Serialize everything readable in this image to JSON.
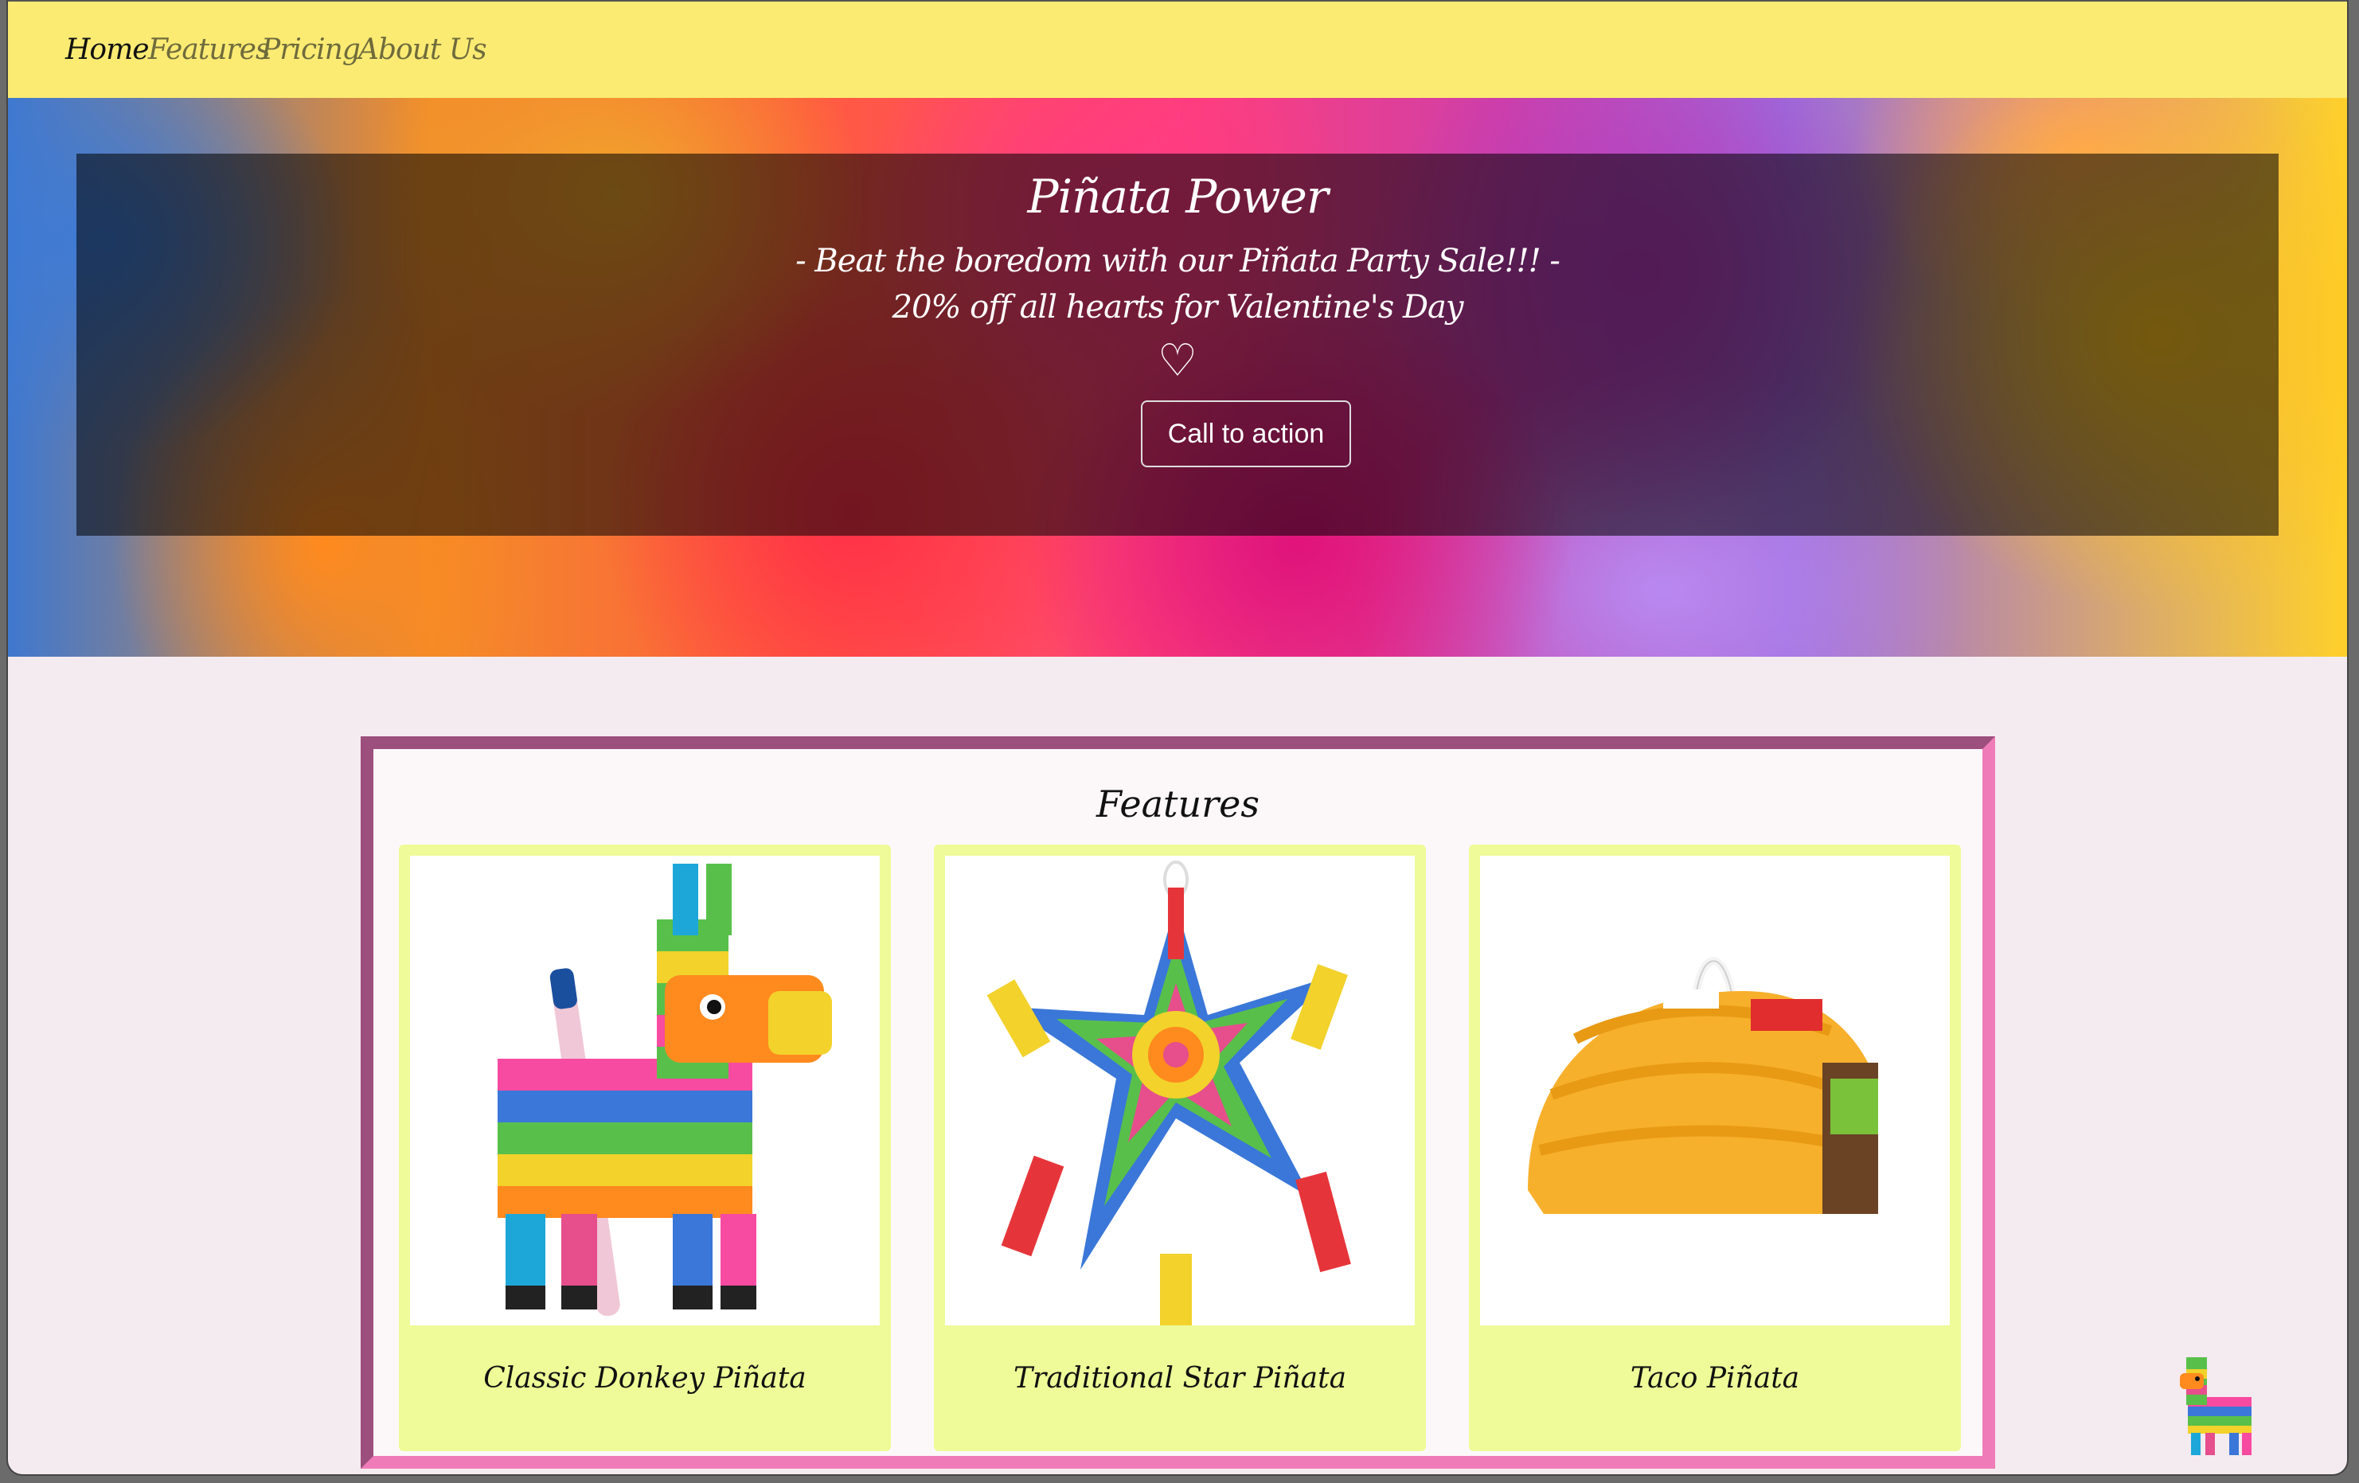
{
  "nav": {
    "items": [
      {
        "label": "Home",
        "active": true
      },
      {
        "label": "Features",
        "active": false
      },
      {
        "label": "Pricing",
        "active": false
      },
      {
        "label": "About Us",
        "active": false
      }
    ]
  },
  "hero": {
    "title": "Piñata Power",
    "subtitle_line1": "- Beat the boredom with our Piñata Party Sale!!! -",
    "subtitle_line2": "20% off all hearts for Valentine's Day",
    "heart": "♡",
    "cta_label": "Call to action"
  },
  "features": {
    "title": "Features",
    "cards": [
      {
        "label": "Classic Donkey Piñata",
        "icon": "donkey-pinata-icon"
      },
      {
        "label": "Traditional Star Piñata",
        "icon": "star-pinata-icon"
      },
      {
        "label": "Taco Piñata",
        "icon": "taco-pinata-icon"
      }
    ]
  },
  "colors": {
    "navbar": "#fbeb73",
    "page_bg": "#f4ebf0",
    "card_bg": "#eefb98",
    "frame_dark": "#9c4e7c",
    "frame_light": "#ef7cb8"
  }
}
